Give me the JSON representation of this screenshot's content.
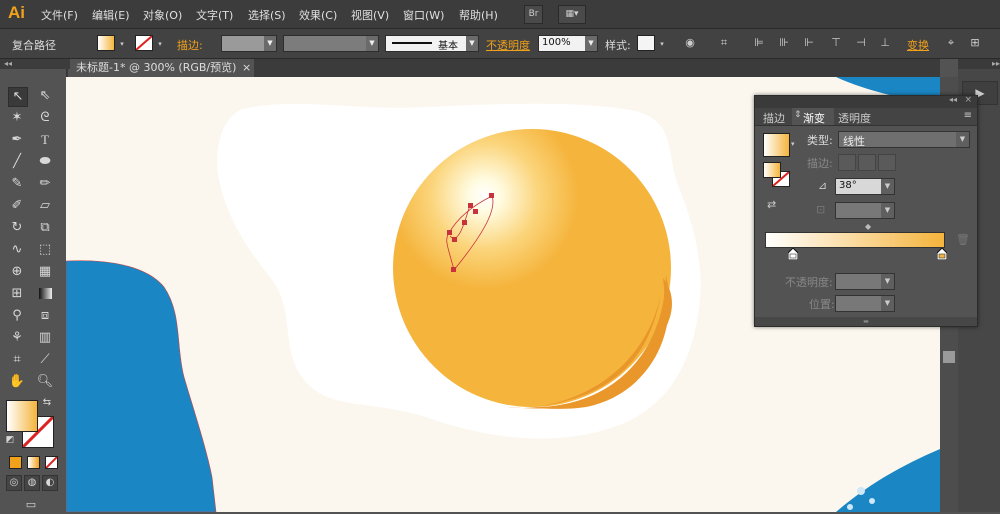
{
  "app": {
    "logo": "Ai"
  },
  "menu": {
    "items": [
      "文件(F)",
      "编辑(E)",
      "对象(O)",
      "文字(T)",
      "选择(S)",
      "效果(C)",
      "视图(V)",
      "窗口(W)",
      "帮助(H)"
    ],
    "br_label": "Br"
  },
  "control_bar": {
    "object_type": "复合路径",
    "stroke_label": "描边:",
    "stroke_profile": "基本",
    "opacity_label": "不透明度",
    "opacity_value": "100%",
    "style_label": "样式:",
    "transform_label": "变换"
  },
  "document": {
    "tab_title": "未标题-1* @ 300% (RGB/预览)",
    "close": "×"
  },
  "gradient_panel": {
    "tabs": [
      "描边",
      "渐变",
      "透明度"
    ],
    "type_label": "类型:",
    "type_value": "线性",
    "stroke_label": "描边:",
    "angle_value": "38°",
    "opacity_label": "不透明度:",
    "location_label": "位置:"
  },
  "colors": {
    "accent_orange": "#f2a11a",
    "yolk": "#f5b43c",
    "yolk_shadow": "#e9962a",
    "blue": "#1a86c4",
    "canvas_bg": "#fbf7ee",
    "gradient_start": "#ffffff",
    "gradient_end": "#f5b43c"
  }
}
